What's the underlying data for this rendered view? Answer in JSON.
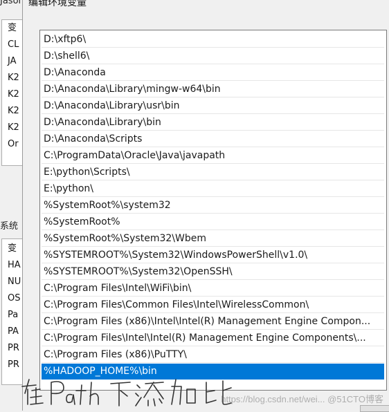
{
  "parent_window": {
    "title_fragment": "Jason",
    "section_label": "系统",
    "user_vars": [
      "变",
      "CL",
      "JA",
      "K2",
      "K2",
      "K2",
      "K2",
      "Or"
    ],
    "system_vars": [
      "变",
      "HA",
      "NU",
      "OS",
      "Pa",
      "PA",
      "PR",
      "PR"
    ]
  },
  "dialog": {
    "title": "编辑环境变量",
    "path_entries": [
      "D:\\xftp6\\",
      "D:\\shell6\\",
      "D:\\Anaconda",
      "D:\\Anaconda\\Library\\mingw-w64\\bin",
      "D:\\Anaconda\\Library\\usr\\bin",
      "D:\\Anaconda\\Library\\bin",
      "D:\\Anaconda\\Scripts",
      "C:\\ProgramData\\Oracle\\Java\\javapath",
      "E:\\python\\Scripts\\",
      "E:\\python\\",
      "%SystemRoot%\\system32",
      "%SystemRoot%",
      "%SystemRoot%\\System32\\Wbem",
      "%SYSTEMROOT%\\System32\\WindowsPowerShell\\v1.0\\",
      "%SYSTEMROOT%\\System32\\OpenSSH\\",
      "C:\\Program Files\\Intel\\WiFi\\bin\\",
      "C:\\Program Files\\Common Files\\Intel\\WirelessCommon\\",
      "C:\\Program Files (x86)\\Intel\\Intel(R) Management Engine Compon...",
      "C:\\Program Files\\Intel\\Intel(R) Management Engine Components\\...",
      "C:\\Program Files (x86)\\PuTTY\\",
      "%HADOOP_HOME%\\bin"
    ],
    "selected_index": 20
  },
  "annotation": {
    "handwritten_text": "在Path下添加"
  },
  "watermark": "https://blog.csdn.net/wei... @51CTO博客"
}
